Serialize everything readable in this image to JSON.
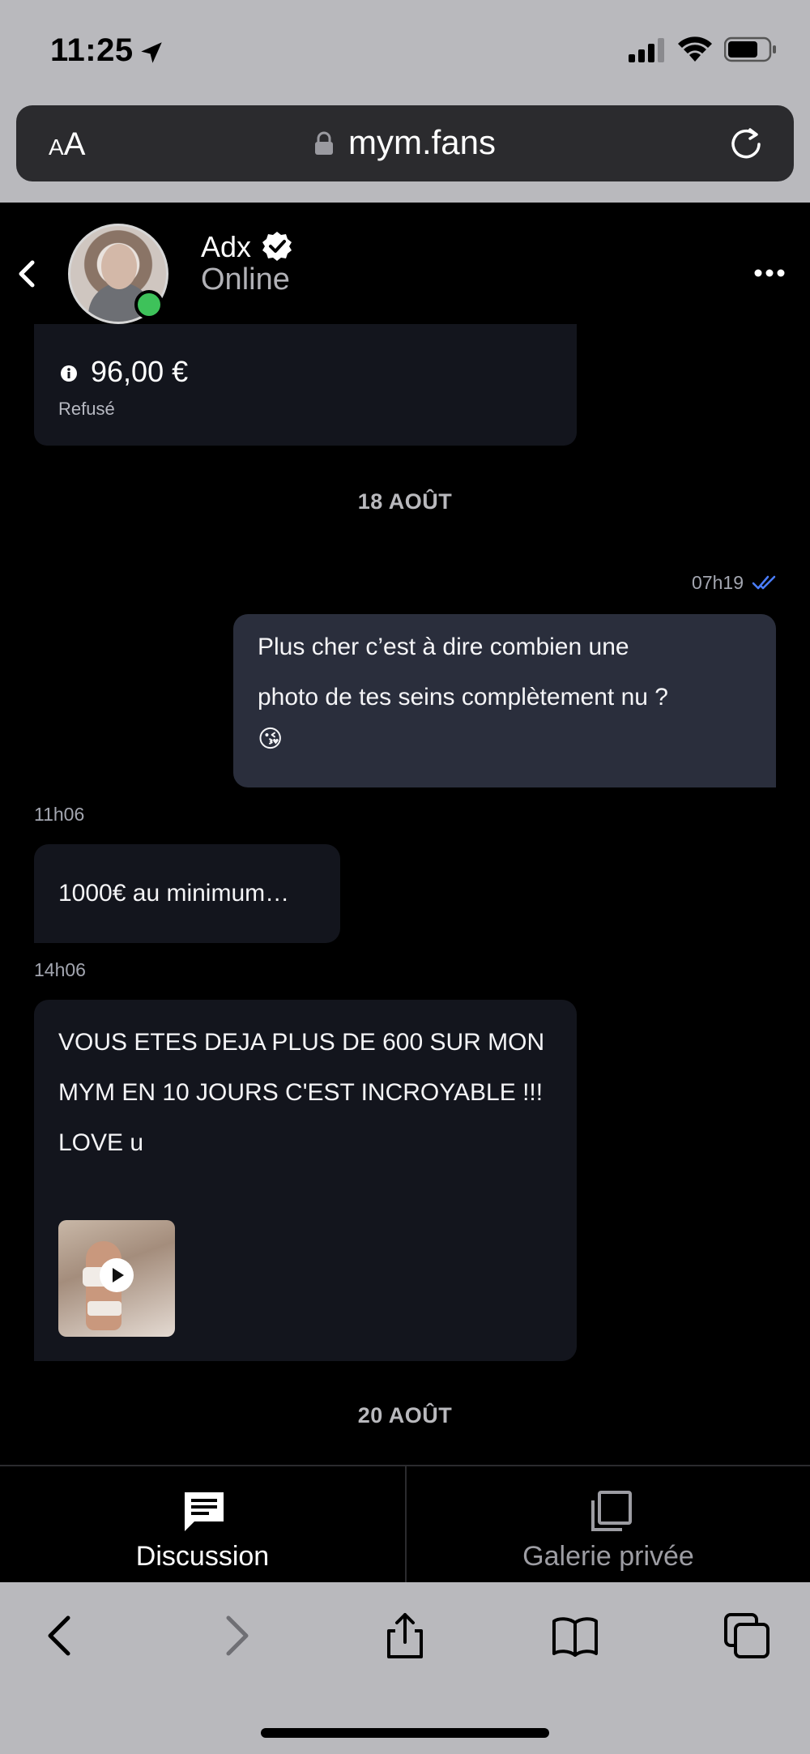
{
  "status_bar": {
    "time": "11:25"
  },
  "browser": {
    "text_size_label_small": "A",
    "text_size_label_large": "A",
    "url": "mym.fans"
  },
  "chat": {
    "contact_name": "Adx",
    "contact_status": "Online"
  },
  "offer": {
    "amount": "96,00 €",
    "status": "Refusé"
  },
  "messages": {
    "date_1": "18 AOÛT",
    "out_1": {
      "time": "07h19",
      "text_line_1": "Plus cher c’est à dire combien une",
      "text_line_2": "photo de tes seins complètement nu ?",
      "emoji": "😘"
    },
    "in_1": {
      "time": "11h06",
      "text": "1000€ au minimum…"
    },
    "in_2": {
      "time": "14h06",
      "text_line_1": "VOUS ETES DEJA PLUS DE 600 SUR MON",
      "text_line_2": "MYM EN 10 JOURS C'EST INCROYABLE !!!",
      "text_line_3": "LOVE u"
    },
    "date_2": "20 AOÛT"
  },
  "tabs": [
    {
      "label": "Discussion",
      "active": true
    },
    {
      "label": "Galerie privée",
      "active": false
    }
  ],
  "icons": {
    "location": "location-arrow-icon",
    "lock": "lock-icon",
    "reload": "reload-icon",
    "verified": "verified-badge-icon",
    "more": "more-dots-icon",
    "play": "play-icon"
  },
  "colors": {
    "online": "#3ec25a",
    "read_receipt": "#4a7dff",
    "bubble_in": "#13151d",
    "bubble_out": "#2a2e3c"
  }
}
